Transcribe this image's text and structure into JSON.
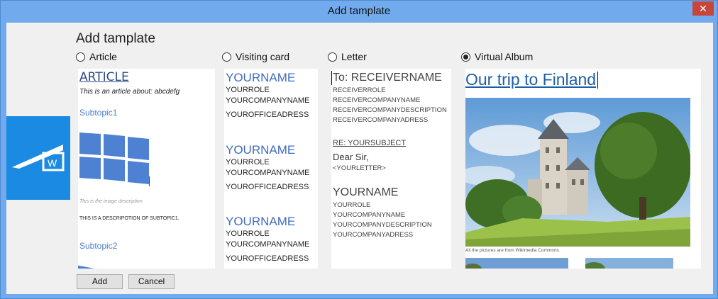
{
  "window": {
    "title": "Add tamplate",
    "close_symbol": "✕"
  },
  "dialog": {
    "heading": "Add tamplate",
    "options": [
      {
        "label": "Article",
        "checked": false
      },
      {
        "label": "Visiting card",
        "checked": false
      },
      {
        "label": "Letter",
        "checked": false
      },
      {
        "label": "Virtual Album",
        "checked": true
      }
    ]
  },
  "article_preview": {
    "title": "ARTICLE",
    "description": "This is an article about: abcdefg",
    "subtopic1": "Subtopic1",
    "image_caption": "This is the image description",
    "subtopic_text": "THIS IS A DESCRIPOTION OF SUBTOPIC1.",
    "subtopic2": "Subtopic2"
  },
  "card_preview": {
    "cards": [
      {
        "name": "YOURNAME",
        "role": "YOURROLE",
        "company": "YOURCOMPANYNAME",
        "office": "YOUROFFICEADRESS"
      },
      {
        "name": "YOURNAME",
        "role": "YOURROLE",
        "company": "YOURCOMPANYNAME",
        "office": "YOUROFFICEADRESS"
      },
      {
        "name": "YOURNAME",
        "role": "YOURROLE",
        "company": "YOURCOMPANYNAME",
        "office": "YOUROFFICEADRESS"
      }
    ]
  },
  "letter_preview": {
    "to": "To: RECEIVERNAME",
    "receiver_lines": [
      "RECEIVERROLE",
      "RECEIVERCOMPANYNAME",
      "RECEIVERCOMPANYDESCRIPTION",
      "RECEIVERCOMPANYADRESS"
    ],
    "subject": "RE: YOURSUBJECT",
    "salutation": "Dear Sir,",
    "body": "<YOURLETTER>",
    "sender_name": "YOURNAME",
    "sender_lines": [
      "YOURROLE",
      "YOURCOMPANYNAME",
      "YOURCOMPANYDESCRIPTION",
      "YOURCOMPANYADRESS"
    ]
  },
  "album_preview": {
    "title": "Our trip to Finland",
    "caption": "All the pictures are from Wikimedia Commons"
  },
  "buttons": {
    "add": "Add",
    "cancel": "Cancel"
  },
  "logo": {
    "letter": "W"
  },
  "colors": {
    "titlebar": "#71abee",
    "close": "#c7453b",
    "word_blue": "#1b8ae3",
    "accent_text": "#3f6bc0"
  }
}
